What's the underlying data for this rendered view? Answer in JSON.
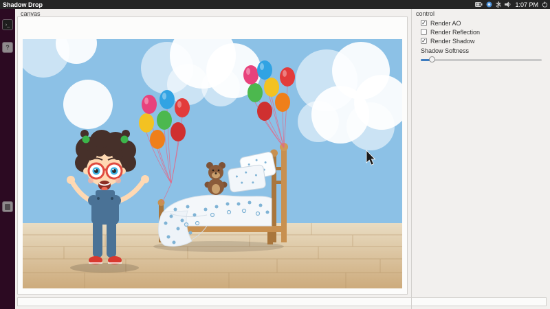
{
  "top_bar": {
    "title": "Shadow Drop",
    "clock": "1:07 PM",
    "tray": [
      "battery-icon",
      "network-icon",
      "bluetooth-icon",
      "volume-icon",
      "power-icon"
    ]
  },
  "launcher": {
    "help_glyph": "?",
    "items": [
      "terminal",
      "help",
      "trash"
    ]
  },
  "panels": {
    "canvas_label": "canvas",
    "control_label": "control"
  },
  "controls": {
    "checkboxes": [
      {
        "label": "Render AO",
        "checked": true,
        "mark": "✓"
      },
      {
        "label": "Render Reflection",
        "checked": false,
        "mark": ""
      },
      {
        "label": "Render Shadow",
        "checked": true,
        "mark": "✓"
      }
    ],
    "slider_label": "Shadow Softness",
    "slider_percent": 9
  },
  "scene": {
    "elements": [
      "sky",
      "clouds",
      "wood-floor",
      "bed",
      "pillows",
      "polka-dot-blanket",
      "teddy-bear",
      "balloon-bunch-left",
      "balloon-bunch-right",
      "cartoon-girl",
      "mouse-cursor"
    ],
    "balloon_colors_left": [
      "#e8427c",
      "#31a3e3",
      "#e23b3b",
      "#f3c222",
      "#4cb84e",
      "#ef7f1a",
      "#cf3030"
    ],
    "balloon_colors_right": [
      "#e8427c",
      "#31a3e3",
      "#4cb84e",
      "#f3c222",
      "#e23b3b",
      "#ef7f1a",
      "#cf3030"
    ]
  },
  "colors": {
    "topbar": "#252525",
    "launcher": "#2c0a22",
    "window_bg": "#f2f0ee",
    "border": "#d2d0cd",
    "sky": "#8cc1e6",
    "cloud": "#ffffff",
    "floor_light": "#e9dcc2",
    "floor_dark": "#cdab7c",
    "wood": "#c89050",
    "wood_dark": "#a9763c",
    "polka": "#7fb3d5",
    "hair": "#46302a",
    "skin": "#ffd9b3",
    "overall": "#4a7296",
    "shoe": "#d8392f",
    "glasses": "#e04b3f",
    "tie": "#3cb54a",
    "slider_fill": "#3d7bbf",
    "bal_pink": "#e8427c",
    "bal_blue": "#31a3e3",
    "bal_green": "#4cb84e",
    "bal_yellow": "#f3c222",
    "bal_red": "#e23b3b",
    "bal_orange": "#ef7f1a",
    "bal_darkred": "#cf3030"
  }
}
